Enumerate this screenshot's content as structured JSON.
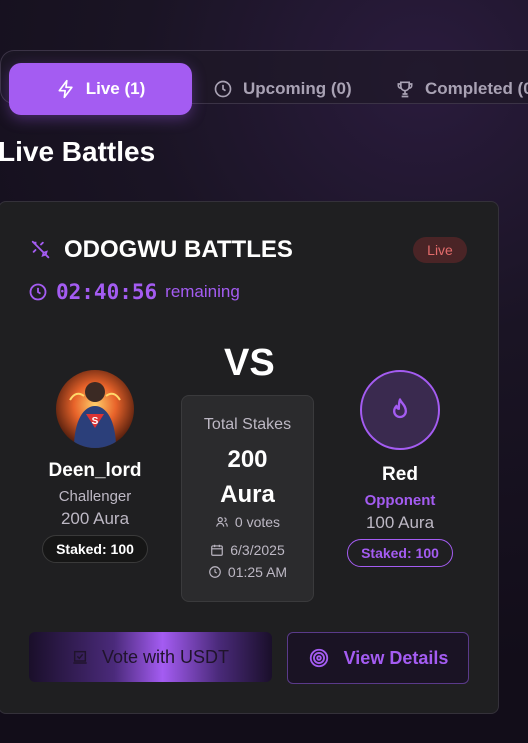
{
  "tabs": [
    {
      "label": "Live (1)",
      "icon": "lightning-icon",
      "active": true
    },
    {
      "label": "Upcoming (0)",
      "icon": "clock-icon",
      "active": false
    },
    {
      "label": "Completed (0",
      "icon": "trophy-icon",
      "active": false
    }
  ],
  "section_title": "Live Battles",
  "battle": {
    "title": "ODOGWU BATTLES",
    "status_badge": "Live",
    "timer": "02:40:56",
    "timer_label": "remaining",
    "vs_label": "VS",
    "challenger": {
      "name": "Deen_lord",
      "role": "Challenger",
      "aura": "200 Aura",
      "staked": "Staked: 100"
    },
    "opponent": {
      "name": "Red",
      "role": "Opponent",
      "aura": "100 Aura",
      "staked": "Staked: 100"
    },
    "stakes": {
      "label": "Total Stakes",
      "amount": "200",
      "unit": "Aura",
      "votes": "0 votes",
      "date": "6/3/2025",
      "time": "01:25 AM"
    },
    "vote_button": "Vote with USDT",
    "details_button": "View Details"
  },
  "colors": {
    "accent": "#a45cf2",
    "live_badge_bg": "#4a2426",
    "live_badge_text": "#e36b6b"
  }
}
